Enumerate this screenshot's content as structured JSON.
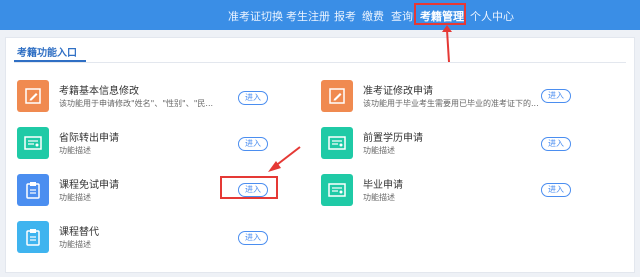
{
  "nav": {
    "items": [
      {
        "label": "准考证切换"
      },
      {
        "label": "考生注册"
      },
      {
        "label": "报考"
      },
      {
        "label": "缴费"
      },
      {
        "label": "查询"
      },
      {
        "label": "考籍管理",
        "active": true
      },
      {
        "label": "个人中心"
      }
    ]
  },
  "tab": {
    "label": "考籍功能入口"
  },
  "items": [
    {
      "title": "考籍基本信息修改",
      "desc": "该功能用于申请修改\"姓名\"、\"性别\"、\"民...",
      "button": "进入",
      "icon": "edit-icon",
      "color": "#f08a50"
    },
    {
      "title": "准考证修改申请",
      "desc": "该功能用于毕业考生需要用已毕业的准考证下的...",
      "button": "进入",
      "icon": "edit-icon",
      "color": "#f08a50"
    },
    {
      "title": "省际转出申请",
      "desc": "功能描述",
      "button": "进入",
      "icon": "certificate-icon",
      "color": "#1fcaa6"
    },
    {
      "title": "前置学历申请",
      "desc": "功能描述",
      "button": "进入",
      "icon": "certificate-icon",
      "color": "#1fcaa6"
    },
    {
      "title": "课程免试申请",
      "desc": "功能描述",
      "button": "进入",
      "icon": "clipboard-icon",
      "color": "#4b8ef0"
    },
    {
      "title": "毕业申请",
      "desc": "功能描述",
      "button": "进入",
      "icon": "certificate-icon",
      "color": "#1fcaa6"
    },
    {
      "title": "课程替代",
      "desc": "功能描述",
      "button": "进入",
      "icon": "clipboard-icon",
      "color": "#3fb4ef"
    }
  ],
  "colors": {
    "topbar": "#3a8ee6",
    "highlight": "#e53935",
    "accent": "#4b8ef0"
  }
}
